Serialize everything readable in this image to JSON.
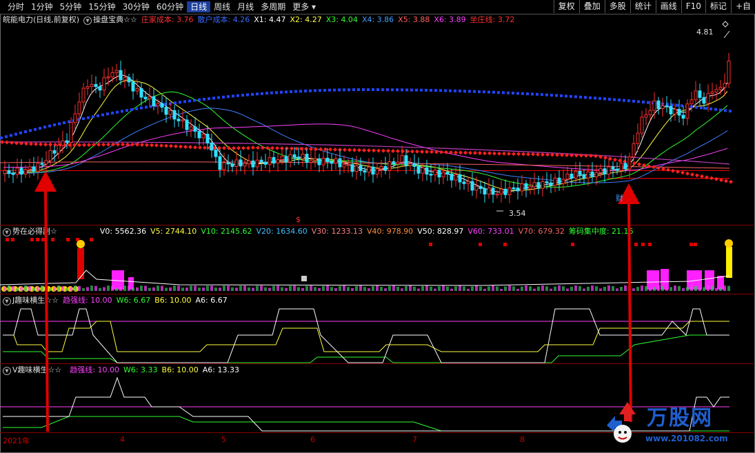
{
  "toolbar": {
    "periods": [
      "分时",
      "1分钟",
      "5分钟",
      "15分钟",
      "30分钟",
      "60分钟",
      "日线",
      "周线",
      "月线",
      "多周期",
      "更多 ▾"
    ],
    "active_period": "日线",
    "right_buttons": [
      "复权",
      "叠加",
      "多股",
      "统计",
      "画线",
      "F10",
      "标记",
      "+自"
    ]
  },
  "main_panel": {
    "stock": "皖能电力(日线,前复权)",
    "indicator": "操盘宝典☆☆",
    "fields": [
      {
        "label": "庄家成本:",
        "value": "3.76",
        "color": "#ff3030"
      },
      {
        "label": "散户成本:",
        "value": "4.26",
        "color": "#3a6bff"
      },
      {
        "label": "X1:",
        "value": "4.47",
        "color": "#ffffff"
      },
      {
        "label": "X2:",
        "value": "4.27",
        "color": "#ffff40"
      },
      {
        "label": "X3:",
        "value": "4.04",
        "color": "#30ff30"
      },
      {
        "label": "X4:",
        "value": "3.86",
        "color": "#40a0ff"
      },
      {
        "label": "X5:",
        "value": "3.88",
        "color": "#ff6060"
      },
      {
        "label": "X6:",
        "value": "3.89",
        "color": "#ff40ff"
      },
      {
        "label": "坐庄线:",
        "value": "3.72",
        "color": "#ff3030"
      }
    ],
    "high_label": "4.81",
    "low_label": "3.54",
    "marker_fin": "财",
    "marker_s": "$"
  },
  "volume_panel": {
    "indicator": "势在必得副☆",
    "fields": [
      {
        "label": "V0:",
        "value": "5562.36",
        "color": "#ffffff"
      },
      {
        "label": "V5:",
        "value": "2744.10",
        "color": "#ffff40"
      },
      {
        "label": "V10:",
        "value": "2145.62",
        "color": "#30ff30"
      },
      {
        "label": "V20:",
        "value": "1634.60",
        "color": "#40c0ff"
      },
      {
        "label": "V30:",
        "value": "1233.13",
        "color": "#ff8080"
      },
      {
        "label": "V40:",
        "value": "978.90",
        "color": "#ff9040"
      },
      {
        "label": "V50:",
        "value": "828.97",
        "color": "#ffffff"
      },
      {
        "label": "V60:",
        "value": "733.01",
        "color": "#ff40ff"
      },
      {
        "label": "V70:",
        "value": "679.32",
        "color": "#ff6060"
      },
      {
        "label": "筹码集中度:",
        "value": "21.16",
        "color": "#30ff30"
      }
    ]
  },
  "j_panel": {
    "indicator": "J趣味横生☆☆",
    "fields": [
      {
        "label": "趋强线:",
        "value": "10.00",
        "color": "#ff40ff"
      },
      {
        "label": "W6:",
        "value": "6.67",
        "color": "#30ff30"
      },
      {
        "label": "B6:",
        "value": "10.00",
        "color": "#ffff40"
      },
      {
        "label": "A6:",
        "value": "6.67",
        "color": "#ffffff"
      }
    ]
  },
  "v_panel": {
    "indicator": "V趣味横生☆☆",
    "fields": [
      {
        "label": "趋强线:",
        "value": "10.00",
        "color": "#ff40ff"
      },
      {
        "label": "W6:",
        "value": "3.33",
        "color": "#30ff30"
      },
      {
        "label": "B6:",
        "value": "10.00",
        "color": "#ffff40"
      },
      {
        "label": "A6:",
        "value": "13.33",
        "color": "#ffffff"
      }
    ]
  },
  "x_axis": [
    "2021年",
    "4",
    "5",
    "6",
    "7",
    "8"
  ],
  "watermark": {
    "title": "万股网",
    "url": "www.201082.com"
  }
}
